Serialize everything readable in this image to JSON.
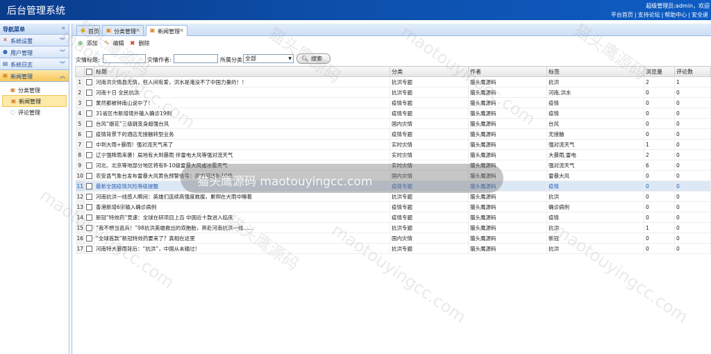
{
  "app": {
    "title": "后台管理系统",
    "user_info": "超级管理员:admin，欢迎",
    "top_links": [
      "平台首页",
      "支持论坛",
      "帮助中心",
      "安全退"
    ]
  },
  "sidebar": {
    "header": "导航菜单",
    "collapse_icon": "«",
    "groups": [
      {
        "label": "系统设置",
        "icon": "tools-icon"
      },
      {
        "label": "用户管理",
        "icon": "users-icon"
      },
      {
        "label": "系统日志",
        "icon": "log-icon"
      },
      {
        "label": "新闻管理",
        "icon": "news-icon"
      }
    ],
    "sub_items": [
      {
        "label": "分类管理",
        "icon": "category-icon"
      },
      {
        "label": "新闻管理",
        "icon": "news-icon"
      },
      {
        "label": "评论管理",
        "icon": "comment-icon"
      }
    ]
  },
  "tabs": [
    {
      "label": "首页",
      "icon": "bulb-icon"
    },
    {
      "label": "分类管理",
      "icon": "category-icon",
      "close": "×"
    },
    {
      "label": "新闻管理",
      "icon": "news-icon",
      "close": "×"
    }
  ],
  "toolbar": {
    "add": "添加",
    "edit": "编辑",
    "delete": "删除"
  },
  "filters": {
    "title_label": "灾情标题:",
    "author_label": "灾情作者:",
    "category_label": "所属分类:",
    "category_value": "全部",
    "search_label": "搜索"
  },
  "table": {
    "headers": [
      "",
      "标题",
      "分类",
      "作者",
      "标签",
      "浏览量",
      "评论数"
    ],
    "rows": [
      {
        "n": "1",
        "title": "河南洪灾情县无情，但人间有爱，洪水是淹没不了中国力量的！！",
        "cat": "抗洪专题",
        "author": "猫头鹰源码",
        "tag": "抗洪",
        "views": "2",
        "comments": "1"
      },
      {
        "n": "2",
        "title": "河南十日 全民抗洪",
        "cat": "抗洪专题",
        "author": "猫头鹰源码",
        "tag": "河南,洪水",
        "views": "0",
        "comments": "0"
      },
      {
        "n": "3",
        "title": "果然都被钟南山说中了！",
        "cat": "疫情专题",
        "author": "猫头鹰源码",
        "tag": "疫情",
        "views": "0",
        "comments": "0"
      },
      {
        "n": "4",
        "title": "31省区市新增境外输入确诊19例",
        "cat": "疫情专题",
        "author": "猫头鹰源码",
        "tag": "疫情",
        "views": "0",
        "comments": "0"
      },
      {
        "n": "5",
        "title": "台风“烟花”三级跳变身超强台风",
        "cat": "国内灾情",
        "author": "猫头鹰源码",
        "tag": "台风",
        "views": "0",
        "comments": "0"
      },
      {
        "n": "6",
        "title": "疫情背景下的酒店无接触转型业务",
        "cat": "疫情专题",
        "author": "猫头鹰源码",
        "tag": "无接触",
        "views": "0",
        "comments": "0"
      },
      {
        "n": "7",
        "title": "中到大雨+暴雨！强对流天气来了",
        "cat": "实时灾情",
        "author": "猫头鹰源码",
        "tag": "强对流天气",
        "views": "1",
        "comments": "0"
      },
      {
        "n": "8",
        "title": "辽宁强降雨来袭！局地有大到暴雨 伴雷电大风等强对流天气",
        "cat": "实时灾情",
        "author": "猫头鹰源码",
        "tag": "大暴雨,雷电",
        "views": "2",
        "comments": "0"
      },
      {
        "n": "9",
        "title": "河北、北京等地部分地区将有8-10级雷暴大风或冰雹天气",
        "cat": "实时灾情",
        "author": "猫头鹰源码",
        "tag": "强对流天气",
        "views": "6",
        "comments": "0"
      },
      {
        "n": "10",
        "title": "农安县气象台发布雷暴大风黄色预警信号：风力可达8-10级",
        "cat": "国内灾情",
        "author": "猫头鹰源码",
        "tag": "雷暴大风",
        "views": "0",
        "comments": "0"
      },
      {
        "n": "11",
        "title": "最新全国疫情风险等级提醒",
        "cat": "疫情专题",
        "author": "猫头鹰源码",
        "tag": "疫情",
        "views": "0",
        "comments": "0"
      },
      {
        "n": "12",
        "title": "河南抗洪一线感人瞬间：英雄们连续高强度救援，累倒在大雨中睡着",
        "cat": "抗洪专题",
        "author": "猫头鹰源码",
        "tag": "抗洪",
        "views": "0",
        "comments": "0"
      },
      {
        "n": "13",
        "title": "香港新增6宗输入确诊病例",
        "cat": "疫情专题",
        "author": "猫头鹰源码",
        "tag": "确诊病例",
        "views": "0",
        "comments": "0"
      },
      {
        "n": "14",
        "title": "新冠“特效药”竞速：全球在研项目上百 中国近十款进入临床",
        "cat": "疫情专题",
        "author": "猫头鹰源码",
        "tag": "疫情",
        "views": "0",
        "comments": "0"
      },
      {
        "n": "15",
        "title": "“我不想当逃兵！”98抗洪英雄救出的双胞胎，奔赴河南抗洪一线......",
        "cat": "抗洪专题",
        "author": "猫头鹰源码",
        "tag": "抗洪",
        "views": "1",
        "comments": "0"
      },
      {
        "n": "16",
        "title": "“全球首款”新冠特效药要来了？真相在这里",
        "cat": "国内灾情",
        "author": "猫头鹰源码",
        "tag": "新冠",
        "views": "0",
        "comments": "0"
      },
      {
        "n": "17",
        "title": "河南特大暴雨背后：“抗洪”，中国从未输过！",
        "cat": "抗洪专题",
        "author": "猫头鹰源码",
        "tag": "抗洪",
        "views": "0",
        "comments": "0"
      }
    ]
  },
  "watermark": {
    "center": "猫头鹰源码 maotouyingcc.com",
    "tile_cn": "猫头鹰源码",
    "tile_en": "maotouyingcc.com"
  },
  "colors": {
    "header_blue": "#0d4ea9",
    "active_menu": "#f7c75a",
    "highlight_row": "#dde8f6"
  }
}
